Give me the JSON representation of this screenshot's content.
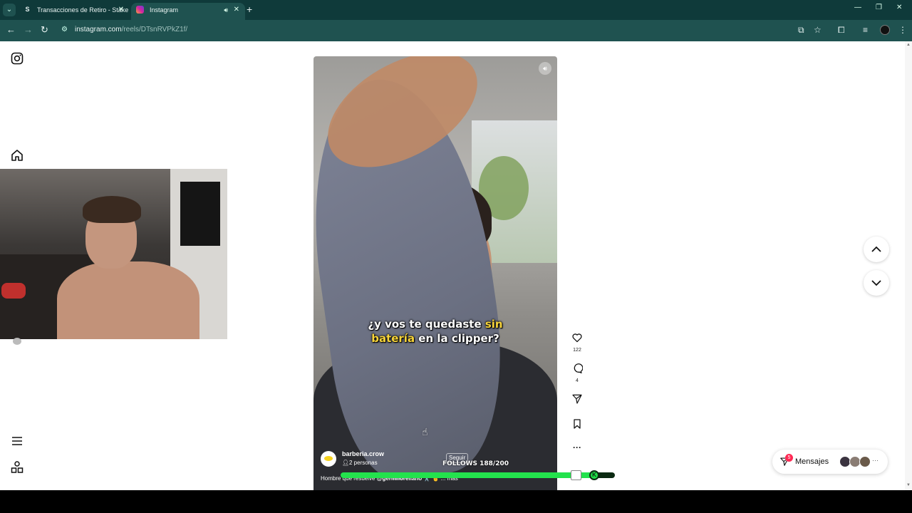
{
  "browser": {
    "tabs": [
      {
        "label": "Transacciones de Retiro - Stake",
        "favicon": "stake-s-icon"
      },
      {
        "label": "Instagram",
        "favicon": "instagram-icon"
      }
    ],
    "url": {
      "host": "instagram.com",
      "path": "/reels/DTsnRVPkZ1f/"
    }
  },
  "sidebar": {
    "icons": [
      "instagram-logo-icon",
      "home-icon",
      "hamburger-menu-icon",
      "more-apps-icon"
    ]
  },
  "reel": {
    "caption_line1_a": "¿y vos te quedaste ",
    "caption_line1_b": "sin",
    "caption_line2_a": "batería",
    "caption_line2_b": " en la clipper?",
    "account": "barberia.crow",
    "followers_note": "2 personas",
    "follow_label": "Seguir",
    "description_a": "Hombre que resuelve ",
    "description_mention": "@germnorellano",
    "description_b": " ✂️ 🤞 ... más",
    "likes": "122",
    "comments": "4"
  },
  "overlay": {
    "follows_text": "FOLLOWS 188/200",
    "follows_progress": 0.94
  },
  "messages": {
    "label": "Mensajes",
    "badge": "5"
  },
  "colors": {
    "chrome_dark": "#0f3a3a",
    "chrome_bar": "#1f5250",
    "caption_highlight": "#f7d43a",
    "progress_green": "#23e24d",
    "badge_red": "#ff2a54"
  }
}
